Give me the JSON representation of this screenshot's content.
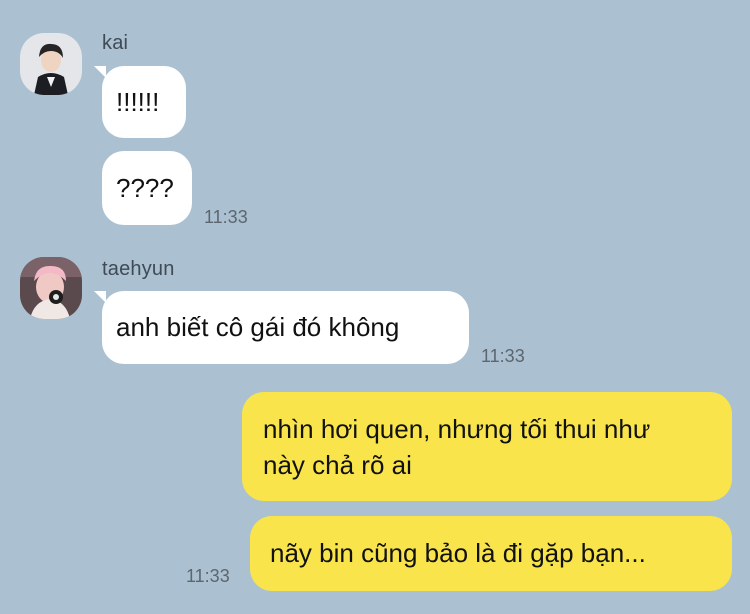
{
  "messages": {
    "kai": {
      "sender": "kai",
      "avatar": "kai-avatar",
      "bubbles": [
        "!!!!!!",
        "????"
      ],
      "time": "11:33"
    },
    "taehyun": {
      "sender": "taehyun",
      "avatar": "taehyun-avatar",
      "bubbles": [
        "anh biết cô gái đó không"
      ],
      "time": "11:33"
    },
    "me": {
      "bubbles": [
        [
          "nhìn hơi quen, nhưng tối thui như",
          "này chả rõ ai"
        ],
        "nãy bin cũng bảo là đi gặp bạn..."
      ],
      "time": "11:33"
    }
  },
  "colors": {
    "background": "#abc1d1",
    "incoming_bubble": "#ffffff",
    "outgoing_bubble": "#f9e54b",
    "timestamp": "#5b6670"
  }
}
